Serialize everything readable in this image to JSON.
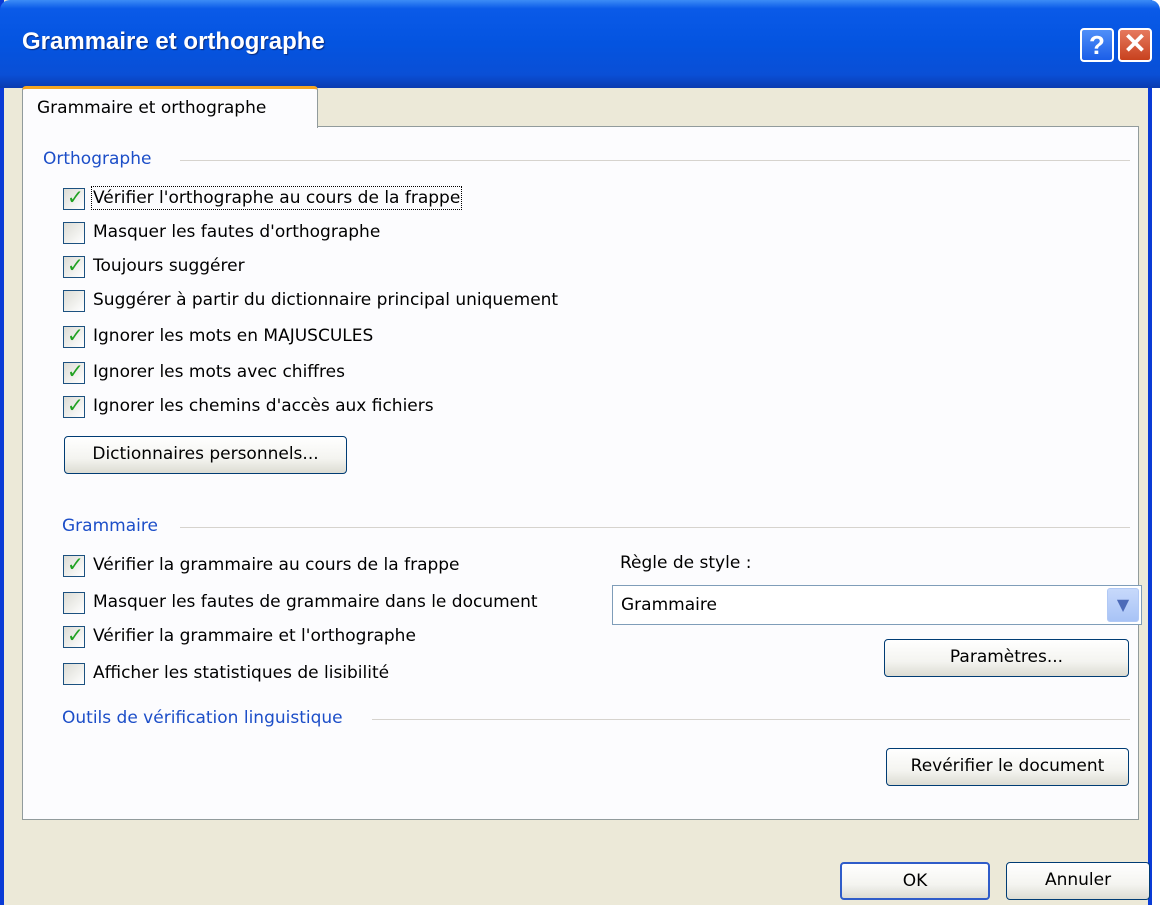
{
  "window": {
    "title": "Grammaire et orthographe"
  },
  "titlebar": {
    "help_glyph": "?",
    "close_glyph": "✕"
  },
  "tab": {
    "label": "Grammaire et orthographe"
  },
  "spelling": {
    "heading": "Orthographe",
    "options": [
      {
        "label": "Vérifier l'orthographe au cours de la frappe",
        "checked": true
      },
      {
        "label": "Masquer les fautes d'orthographe",
        "checked": false
      },
      {
        "label": "Toujours suggérer",
        "checked": true
      },
      {
        "label": "Suggérer à partir du dictionnaire principal uniquement",
        "checked": false
      },
      {
        "label": "Ignorer les mots en MAJUSCULES",
        "checked": true
      },
      {
        "label": "Ignorer les mots avec chiffres",
        "checked": true
      },
      {
        "label": "Ignorer les chemins d'accès aux fichiers",
        "checked": true
      }
    ],
    "dictionaries_button": "Dictionnaires personnels..."
  },
  "grammar": {
    "heading": "Grammaire",
    "options": [
      {
        "label": "Vérifier la grammaire au cours de la frappe",
        "checked": true
      },
      {
        "label": "Masquer les fautes de grammaire dans le document",
        "checked": false
      },
      {
        "label": "Vérifier la grammaire et l'orthographe",
        "checked": true
      },
      {
        "label": "Afficher les statistiques de lisibilité",
        "checked": false
      }
    ],
    "style_label": "Règle de style :",
    "style_value": "Grammaire",
    "settings_button": "Paramètres..."
  },
  "proofing": {
    "heading": "Outils de vérification linguistique",
    "recheck_button": "Revérifier le document"
  },
  "footer": {
    "ok": "OK",
    "cancel": "Annuler"
  },
  "colors": {
    "title_bar": "#0454e0",
    "group_heading": "#1c4ec8",
    "check": "#21a121",
    "dialog_bg": "#ece9d8"
  }
}
